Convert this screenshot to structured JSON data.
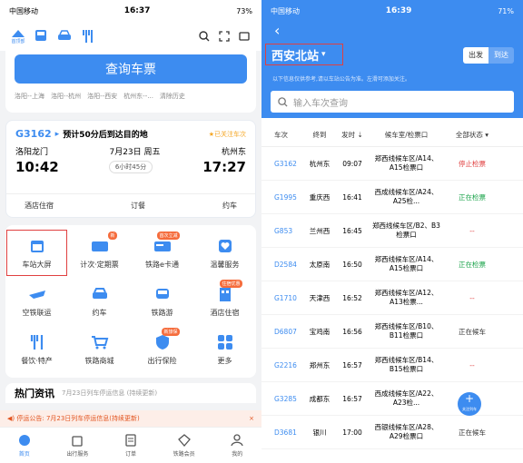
{
  "left": {
    "status": {
      "carrier": "中国移动",
      "time": "16:37",
      "battery": "73%"
    },
    "topbar": {
      "icons": [
        "paper-plane-icon",
        "train-icon",
        "car-icon",
        "food-icon",
        "search-icon",
        "scan-icon",
        "message-icon"
      ],
      "logo_label": "首顶部"
    },
    "query_button": "查询车票",
    "history": [
      "洛阳--上海",
      "洛阳--杭州",
      "洛阳--西安",
      "杭州东--...",
      "清除历史"
    ],
    "trip": {
      "train_no": "G3162",
      "arrow": "▸",
      "message": "预计50分后到达目的地",
      "followed": "已关注车次",
      "from": "洛阳龙门",
      "date": "7月23日 周五",
      "to": "杭州东",
      "depart_time": "10:42",
      "duration": "6小时45分",
      "arrive_time": "17:27",
      "actions": [
        "酒店住宿",
        "订餐",
        "约车"
      ]
    },
    "services": [
      {
        "label": "车站大屏",
        "icon": "calendar-icon",
        "badge": ""
      },
      {
        "label": "计次·定期票",
        "icon": "ticket-icon",
        "badge": "新"
      },
      {
        "label": "铁路e卡通",
        "icon": "card-icon",
        "badge": "首次立减"
      },
      {
        "label": "温馨服务",
        "icon": "heart-icon",
        "badge": ""
      },
      {
        "label": "空铁联运",
        "icon": "plane-icon",
        "badge": ""
      },
      {
        "label": "约车",
        "icon": "car-icon",
        "badge": ""
      },
      {
        "label": "铁路游",
        "icon": "train-icon",
        "badge": ""
      },
      {
        "label": "酒店住宿",
        "icon": "building-icon",
        "badge": "住宿优惠"
      },
      {
        "label": "餐饮·特产",
        "icon": "food-icon",
        "badge": ""
      },
      {
        "label": "铁路商城",
        "icon": "cart-icon",
        "badge": ""
      },
      {
        "label": "出行保险",
        "icon": "shield-icon",
        "badge": "新旅保"
      },
      {
        "label": "更多",
        "icon": "more-icon",
        "badge": ""
      }
    ],
    "hot": {
      "title": "热门资讯",
      "subtitle": "7月23日列车停运信息 (持续更新)"
    },
    "notice": {
      "text": "停运公告: 7月23日列车停运信息(持续更新)",
      "close": "×"
    },
    "tabs": [
      {
        "label": "首页",
        "icon": "home-icon"
      },
      {
        "label": "出行服务",
        "icon": "luggage-icon"
      },
      {
        "label": "订单",
        "icon": "order-icon"
      },
      {
        "label": "铁路会员",
        "icon": "diamond-icon"
      },
      {
        "label": "我的",
        "icon": "user-icon"
      }
    ]
  },
  "right": {
    "status": {
      "carrier": "中国移动",
      "time": "16:39",
      "battery": "71%"
    },
    "back": "‹",
    "station": "西安北站",
    "caret": "▾",
    "segment": [
      "出发",
      "到达"
    ],
    "tip": "以下信息仅供参考,请以车站公告为准。左滑可添加关注。",
    "search_placeholder": "输入车次查询",
    "columns": [
      "车次",
      "终到",
      "发时",
      "候车室/检票口",
      "全部状态"
    ],
    "rows": [
      {
        "train": "G3162",
        "dest": "杭州东",
        "time": "09:07",
        "gate": "郑西线候车区/A14、A15检票口",
        "status": "停止检票",
        "color": "#e04040"
      },
      {
        "train": "G1995",
        "dest": "重庆西",
        "time": "16:41",
        "gate": "西成线候车区/A24、A25检...",
        "status": "正在检票",
        "color": "#1aa34a"
      },
      {
        "train": "G853",
        "dest": "兰州西",
        "time": "16:45",
        "gate": "郑西线候车区/B2、B3检票口",
        "status": "--",
        "color": "#e04040"
      },
      {
        "train": "D2584",
        "dest": "太原南",
        "time": "16:50",
        "gate": "郑西线候车区/A14、A15检票口",
        "status": "正在检票",
        "color": "#1aa34a"
      },
      {
        "train": "G1710",
        "dest": "天津西",
        "time": "16:52",
        "gate": "郑西线候车区/A12、A13检票...",
        "status": "--",
        "color": "#e04040"
      },
      {
        "train": "D6807",
        "dest": "宝鸡南",
        "time": "16:56",
        "gate": "郑西线候车区/B10、B11检票口",
        "status": "正在候车",
        "color": "#333"
      },
      {
        "train": "G2216",
        "dest": "郑州东",
        "time": "16:57",
        "gate": "郑西线候车区/B14、B15检票口",
        "status": "--",
        "color": "#e04040"
      },
      {
        "train": "G3285",
        "dest": "成都东",
        "time": "16:57",
        "gate": "西成线候车区/A22、A23检...",
        "status": "--",
        "color": "#e04040"
      },
      {
        "train": "D3681",
        "dest": "银川",
        "time": "17:00",
        "gate": "西银线候车区/A28、A29检票口",
        "status": "正在候车",
        "color": "#333"
      }
    ],
    "fab": {
      "plus": "+",
      "label": "关注列车"
    }
  }
}
